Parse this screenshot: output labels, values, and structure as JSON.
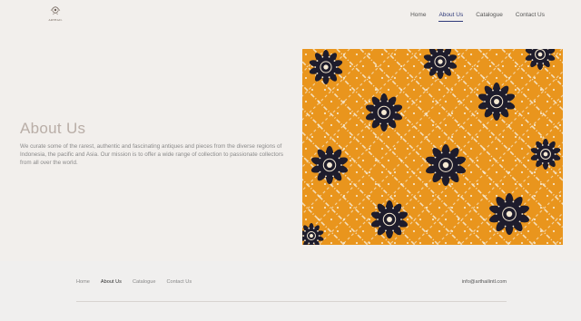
{
  "header": {
    "logo": {
      "name": "logo-icon",
      "text": "ARTHAIL",
      "subtext": ""
    },
    "nav": [
      {
        "label": "Home",
        "active": false
      },
      {
        "label": "About Us",
        "active": true
      },
      {
        "label": "Catalogue",
        "active": false
      },
      {
        "label": "Contact Us",
        "active": false
      }
    ]
  },
  "main": {
    "title": "About Us",
    "description": "We curate some of the rarest, authentic and fascinating antiques and pieces from the diverse regions of Indonesia, the pacific and Asia. Our mission is to offer a wide range of collection to passionate collectors from all over the world.",
    "image": {
      "name": "batik-fabric-image",
      "colors": {
        "base": "#e9951d",
        "flower": "#1e1c2c",
        "line": "#f6ead4"
      }
    }
  },
  "footer": {
    "nav": [
      {
        "label": "Home",
        "active": false
      },
      {
        "label": "About Us",
        "active": true
      },
      {
        "label": "Catalogue",
        "active": false
      },
      {
        "label": "Contact Us",
        "active": false
      }
    ],
    "email": "info@arthailintl.com"
  },
  "colors": {
    "background": "#f2efec",
    "footer": "#f0efee",
    "accent": "#2f3a7a",
    "title": "#b9aea7"
  }
}
